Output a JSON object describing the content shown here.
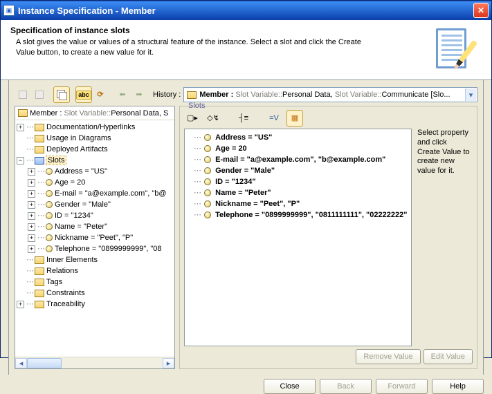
{
  "window": {
    "title": "Instance Specification - Member"
  },
  "header": {
    "heading": "Specification of instance slots",
    "desc": "A slot gives the value or values of a structural feature of the instance. Select a slot and click the Create Value button, to create a new value for it."
  },
  "toolbar": {
    "history_label": "History :",
    "history_prefix": "Member :",
    "history_gray1": "Slot Variable::",
    "history_mid": "Personal Data,",
    "history_gray2": "Slot Variable::",
    "history_tail": "Communicate [Slo..."
  },
  "tree": {
    "head_prefix": "Member :",
    "head_gray": "Slot Variable::",
    "head_tail": "Personal Data, S",
    "items": [
      {
        "label": "Documentation/Hyperlinks"
      },
      {
        "label": "Usage in Diagrams"
      },
      {
        "label": "Deployed Artifacts"
      }
    ],
    "slots_label": "Slots",
    "slots": [
      {
        "label": "Address = \"US\""
      },
      {
        "label": "Age = 20"
      },
      {
        "label": "E-mail = \"a@example.com\", \"b@"
      },
      {
        "label": "Gender = \"Male\""
      },
      {
        "label": "ID = \"1234\""
      },
      {
        "label": "Name = \"Peter\""
      },
      {
        "label": "Nickname = \"Peet\", \"P\""
      },
      {
        "label": "Telephone = \"0899999999\", \"08"
      }
    ],
    "tail_items": [
      {
        "label": "Inner Elements"
      },
      {
        "label": "Relations"
      },
      {
        "label": "Tags"
      },
      {
        "label": "Constraints"
      },
      {
        "label": "Traceability"
      }
    ]
  },
  "slots_panel": {
    "legend": "Slots",
    "hint": "Select property and click Create Value to create new value for it.",
    "rows": [
      {
        "text": "Address = \"US\""
      },
      {
        "text": "Age = 20"
      },
      {
        "text": "E-mail = \"a@example.com\", \"b@example.com\""
      },
      {
        "text": "Gender = \"Male\""
      },
      {
        "text": "ID = \"1234\""
      },
      {
        "text": "Name = \"Peter\""
      },
      {
        "text": "Nickname = \"Peet\", \"P\""
      },
      {
        "text": "Telephone = \"0899999999\", \"0811111111\", \"02222222\""
      }
    ],
    "remove": "Remove Value",
    "edit": "Edit Value",
    "eqv": "=V"
  },
  "footer": {
    "close": "Close",
    "back": "Back",
    "forward": "Forward",
    "help": "Help"
  }
}
